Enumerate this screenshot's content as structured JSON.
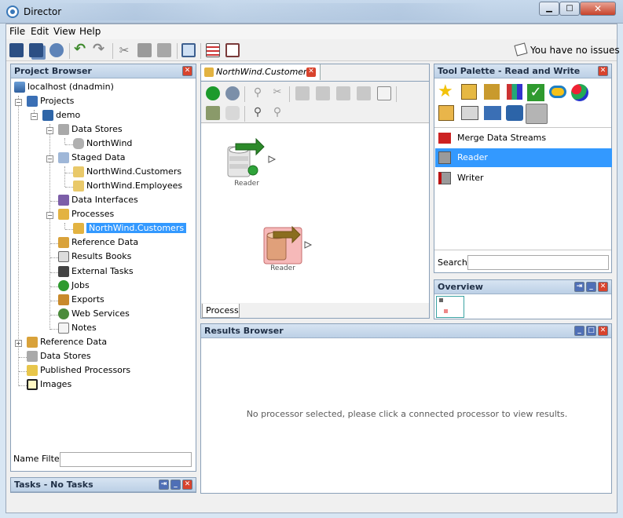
{
  "app": {
    "title": "Director"
  },
  "window_controls": {
    "minimize": "▁",
    "maximize": "□",
    "close": "✕"
  },
  "menu": {
    "items": [
      "File",
      "Edit",
      "View",
      "Help"
    ]
  },
  "toolbar": {
    "issues_text": "You have no issues"
  },
  "project_browser": {
    "title": "Project Browser",
    "tree": [
      {
        "label": "localhost (dnadmin)",
        "icon": "server-icon"
      },
      {
        "label": "Projects",
        "icon": "projects-icon"
      },
      {
        "label": "demo",
        "icon": "project-book-icon"
      },
      {
        "label": "Data Stores",
        "icon": "data-stores-icon"
      },
      {
        "label": "NorthWind",
        "icon": "database-icon"
      },
      {
        "label": "Staged Data",
        "icon": "staged-data-icon"
      },
      {
        "label": "NorthWind.Customers",
        "icon": "staged-item-icon"
      },
      {
        "label": "NorthWind.Employees",
        "icon": "staged-item-icon"
      },
      {
        "label": "Data Interfaces",
        "icon": "data-interfaces-icon"
      },
      {
        "label": "Processes",
        "icon": "processes-icon"
      },
      {
        "label": "NorthWind.Customers",
        "icon": "process-icon"
      },
      {
        "label": "Reference Data",
        "icon": "reference-data-icon"
      },
      {
        "label": "Results Books",
        "icon": "results-books-icon"
      },
      {
        "label": "External Tasks",
        "icon": "external-tasks-icon"
      },
      {
        "label": "Jobs",
        "icon": "jobs-icon"
      },
      {
        "label": "Exports",
        "icon": "exports-icon"
      },
      {
        "label": "Web Services",
        "icon": "web-services-icon"
      },
      {
        "label": "Notes",
        "icon": "notes-icon"
      },
      {
        "label": "Reference Data",
        "icon": "reference-data-icon"
      },
      {
        "label": "Data Stores",
        "icon": "data-stores-icon"
      },
      {
        "label": "Published Processors",
        "icon": "published-processors-icon"
      },
      {
        "label": "Images",
        "icon": "images-icon"
      }
    ],
    "name_filter_label": "Name Filter"
  },
  "tasks": {
    "title": "Tasks - No Tasks"
  },
  "editor": {
    "tab_label": "NorthWind.Customers",
    "bottom_tab": "Process",
    "nodes": [
      {
        "label": "Reader",
        "selected": false
      },
      {
        "label": "Reader",
        "selected": true
      }
    ]
  },
  "tool_palette": {
    "title": "Tool Palette - Read and Write",
    "items": [
      {
        "label": "Merge Data Streams",
        "selected": false
      },
      {
        "label": "Reader",
        "selected": true
      },
      {
        "label": "Writer",
        "selected": false
      }
    ],
    "search_label": "Search"
  },
  "overview": {
    "title": "Overview"
  },
  "results_browser": {
    "title": "Results Browser",
    "message": "No processor selected, please click a connected processor to view results."
  }
}
